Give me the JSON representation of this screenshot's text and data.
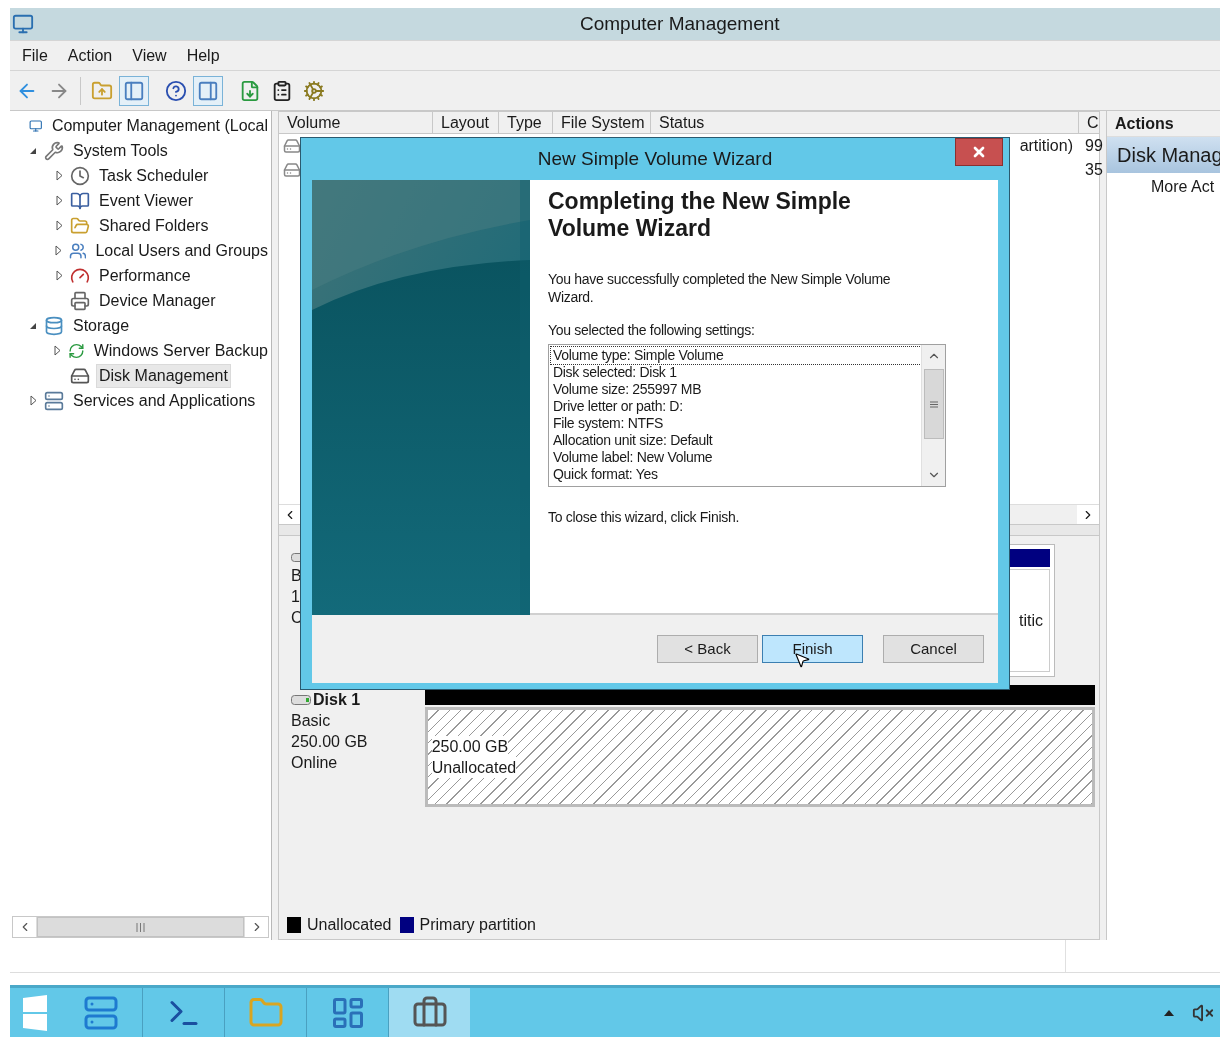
{
  "window": {
    "title": "Computer Management"
  },
  "menu": [
    "File",
    "Action",
    "View",
    "Help"
  ],
  "tree": [
    {
      "label": "Computer Management (Local",
      "selected": false,
      "children": [
        {
          "label": "System Tools",
          "expanded": true,
          "selected": false,
          "children": [
            {
              "label": "Task Scheduler",
              "expanded": false,
              "selected": false
            },
            {
              "label": "Event Viewer",
              "expanded": false,
              "selected": false
            },
            {
              "label": "Shared Folders",
              "expanded": false,
              "selected": false
            },
            {
              "label": "Local Users and Groups",
              "expanded": false,
              "selected": false
            },
            {
              "label": "Performance",
              "expanded": false,
              "selected": false
            },
            {
              "label": "Device Manager",
              "selected": false
            }
          ]
        },
        {
          "label": "Storage",
          "expanded": true,
          "selected": false,
          "children": [
            {
              "label": "Windows Server Backup",
              "expanded": false,
              "selected": false
            },
            {
              "label": "Disk Management",
              "selected": true
            }
          ]
        },
        {
          "label": "Services and Applications",
          "expanded": false,
          "selected": false
        }
      ]
    }
  ],
  "volume_table": {
    "columns": [
      "Volume",
      "Layout",
      "Type",
      "File System",
      "Status",
      "C"
    ],
    "rows": [
      {
        "status": "artition)",
        "column_6": "99"
      },
      {
        "column_6": "35"
      }
    ]
  },
  "disks": [
    {
      "labels": [
        "B",
        "1",
        "C"
      ],
      "partition": {
        "color": "#000080",
        "text": "titic"
      }
    },
    {
      "name": "Disk 1",
      "labels": [
        "Basic",
        "250.00 GB",
        "Online"
      ],
      "partition": {
        "color": "#000000",
        "size": "250.00 GB",
        "text": "Unallocated"
      }
    }
  ],
  "legend": [
    {
      "label": "Unallocated",
      "color": "#000000"
    },
    {
      "label": "Primary partition",
      "color": "#000080"
    }
  ],
  "actions": {
    "header": "Actions",
    "section": "Disk Manag",
    "items": [
      "More Act"
    ]
  },
  "dialog": {
    "title": "New Simple Volume Wizard",
    "heading": "Completing the New Simple Volume Wizard",
    "intro": "You have successfully completed the New Simple Volume Wizard.",
    "settings_label": "You selected the following settings:",
    "settings": [
      {
        "text": "Volume type: Simple Volume",
        "selected": true
      },
      {
        "text": "Disk selected: Disk 1",
        "selected": false
      },
      {
        "text": "Volume size: 255997 MB",
        "selected": false
      },
      {
        "text": "Drive letter or path: D:",
        "selected": false
      },
      {
        "text": "File system: NTFS",
        "selected": false
      },
      {
        "text": "Allocation unit size: Default",
        "selected": false
      },
      {
        "text": "Volume label: New Volume",
        "selected": false
      },
      {
        "text": "Quick format: Yes",
        "selected": false
      }
    ],
    "closing": "To close this wizard, click Finish.",
    "buttons": [
      {
        "label": "< Back",
        "selected": false
      },
      {
        "label": "Finish",
        "selected": true
      },
      {
        "label": "Cancel",
        "selected": false
      }
    ]
  },
  "taskbar": [
    {
      "selected": false
    },
    {
      "selected": false
    },
    {
      "selected": false
    },
    {
      "selected": false
    },
    {
      "selected": true
    }
  ]
}
